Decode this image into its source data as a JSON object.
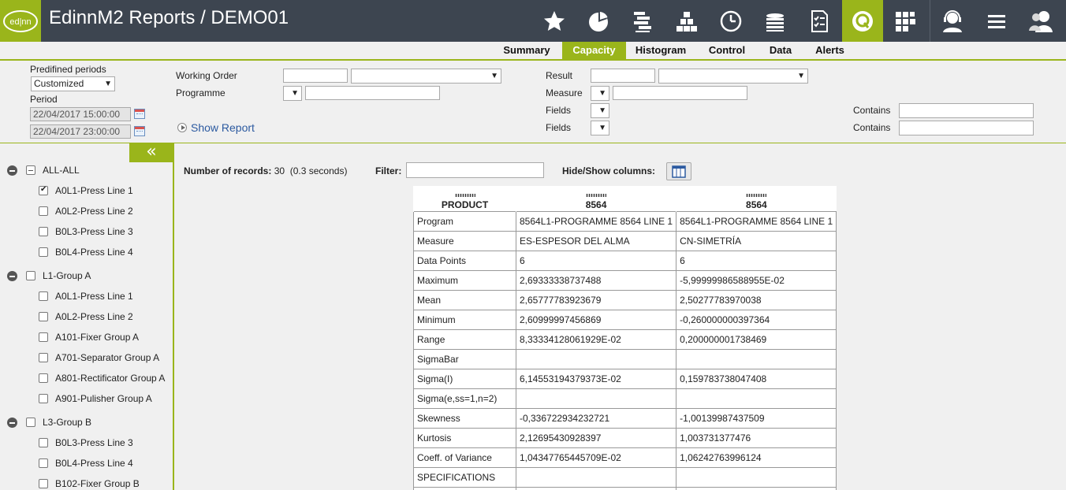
{
  "header": {
    "title": "EdinnM2 Reports / DEMO01",
    "logo_text": "ed|nn",
    "icons": [
      "star-icon",
      "pie-chart-icon",
      "gantt-icon",
      "stack-icon",
      "clock-icon",
      "coins-icon",
      "checklist-icon",
      "q-report-icon",
      "grid-icon",
      "support-agent-icon",
      "menu-icon",
      "users-icon"
    ],
    "accent": "#9ab51b",
    "bar_color": "#3d4550"
  },
  "tabs": [
    {
      "label": "Summary"
    },
    {
      "label": "Capacity"
    },
    {
      "label": "Histogram"
    },
    {
      "label": "Control"
    },
    {
      "label": "Data"
    },
    {
      "label": "Alerts"
    }
  ],
  "active_tab": "Capacity",
  "filters": {
    "predefined_periods_label": "Predifined periods",
    "predefined_periods_value": "Customized",
    "period_label": "Period",
    "period_from": "22/04/2017 15:00:00",
    "period_to": "22/04/2017 23:00:00",
    "working_order_label": "Working Order",
    "programme_label": "Programme",
    "show_report": "Show Report",
    "result_label": "Result",
    "measure_label": "Measure",
    "fields1_label": "Fields",
    "fields2_label": "Fields",
    "contains1_label": "Contains",
    "contains2_label": "Contains"
  },
  "tree": {
    "collapse_label": "«",
    "nodes": [
      {
        "label": "ALL-ALL",
        "level": 0,
        "state": "indeterminate"
      },
      {
        "label": "A0L1-Press Line 1",
        "level": 1,
        "state": "checked"
      },
      {
        "label": "A0L2-Press Line 2",
        "level": 1,
        "state": "unchecked"
      },
      {
        "label": "B0L3-Press Line 3",
        "level": 1,
        "state": "unchecked"
      },
      {
        "label": "B0L4-Press Line 4",
        "level": 1,
        "state": "unchecked"
      },
      {
        "label": "L1-Group A",
        "level": 0,
        "state": "unchecked"
      },
      {
        "label": "A0L1-Press Line 1",
        "level": 1,
        "state": "unchecked"
      },
      {
        "label": "A0L2-Press Line 2",
        "level": 1,
        "state": "unchecked"
      },
      {
        "label": "A101-Fixer Group A",
        "level": 1,
        "state": "unchecked"
      },
      {
        "label": "A701-Separator Group A",
        "level": 1,
        "state": "unchecked"
      },
      {
        "label": "A801-Rectificator Group A",
        "level": 1,
        "state": "unchecked"
      },
      {
        "label": "A901-Pulisher Group A",
        "level": 1,
        "state": "unchecked"
      },
      {
        "label": "L3-Group B",
        "level": 0,
        "state": "unchecked"
      },
      {
        "label": "B0L3-Press Line 3",
        "level": 1,
        "state": "unchecked"
      },
      {
        "label": "B0L4-Press Line 4",
        "level": 1,
        "state": "unchecked"
      },
      {
        "label": "B102-Fixer Group B",
        "level": 1,
        "state": "unchecked"
      }
    ]
  },
  "main": {
    "records_label": "Number of records:",
    "records_count": "30",
    "records_time": "(0.3 seconds)",
    "filter_label": "Filter:",
    "filter_value": "",
    "hide_show_label": "Hide/Show columns:"
  },
  "table": {
    "headers": [
      "PRODUCT",
      "8564",
      "8564"
    ],
    "rows": [
      [
        "Program",
        "8564L1-PROGRAMME 8564 LINE 1",
        "8564L1-PROGRAMME 8564 LINE 1"
      ],
      [
        "Measure",
        "ES-ESPESOR DEL ALMA",
        "CN-SIMETRÍA"
      ],
      [
        "Data Points",
        "6",
        "6"
      ],
      [
        "Maximum",
        "2,69333338737488",
        "-5,99999986588955E-02"
      ],
      [
        "Mean",
        "2,65777783923679",
        "2,50277783970038"
      ],
      [
        "Minimum",
        "2,60999997456869",
        "-0,260000000397364"
      ],
      [
        "Range",
        "8,33334128061929E-02",
        "0,200000001738469"
      ],
      [
        "SigmaBar",
        "",
        ""
      ],
      [
        "Sigma(I)",
        "6,14553194379373E-02",
        "0,159783738047408"
      ],
      [
        "Sigma(e,ss=1,n=2)",
        "",
        ""
      ],
      [
        "Skewness",
        "-0,336722934232721",
        "-1,00139987437509"
      ],
      [
        "Kurtosis",
        "2,12695430928397",
        "1,003731377476"
      ],
      [
        "Coeff. of Variance",
        "1,04347765445709E-02",
        "1,06242763996124"
      ],
      [
        "SPECIFICATIONS",
        "",
        ""
      ],
      [
        "",
        "",
        ""
      ]
    ]
  }
}
